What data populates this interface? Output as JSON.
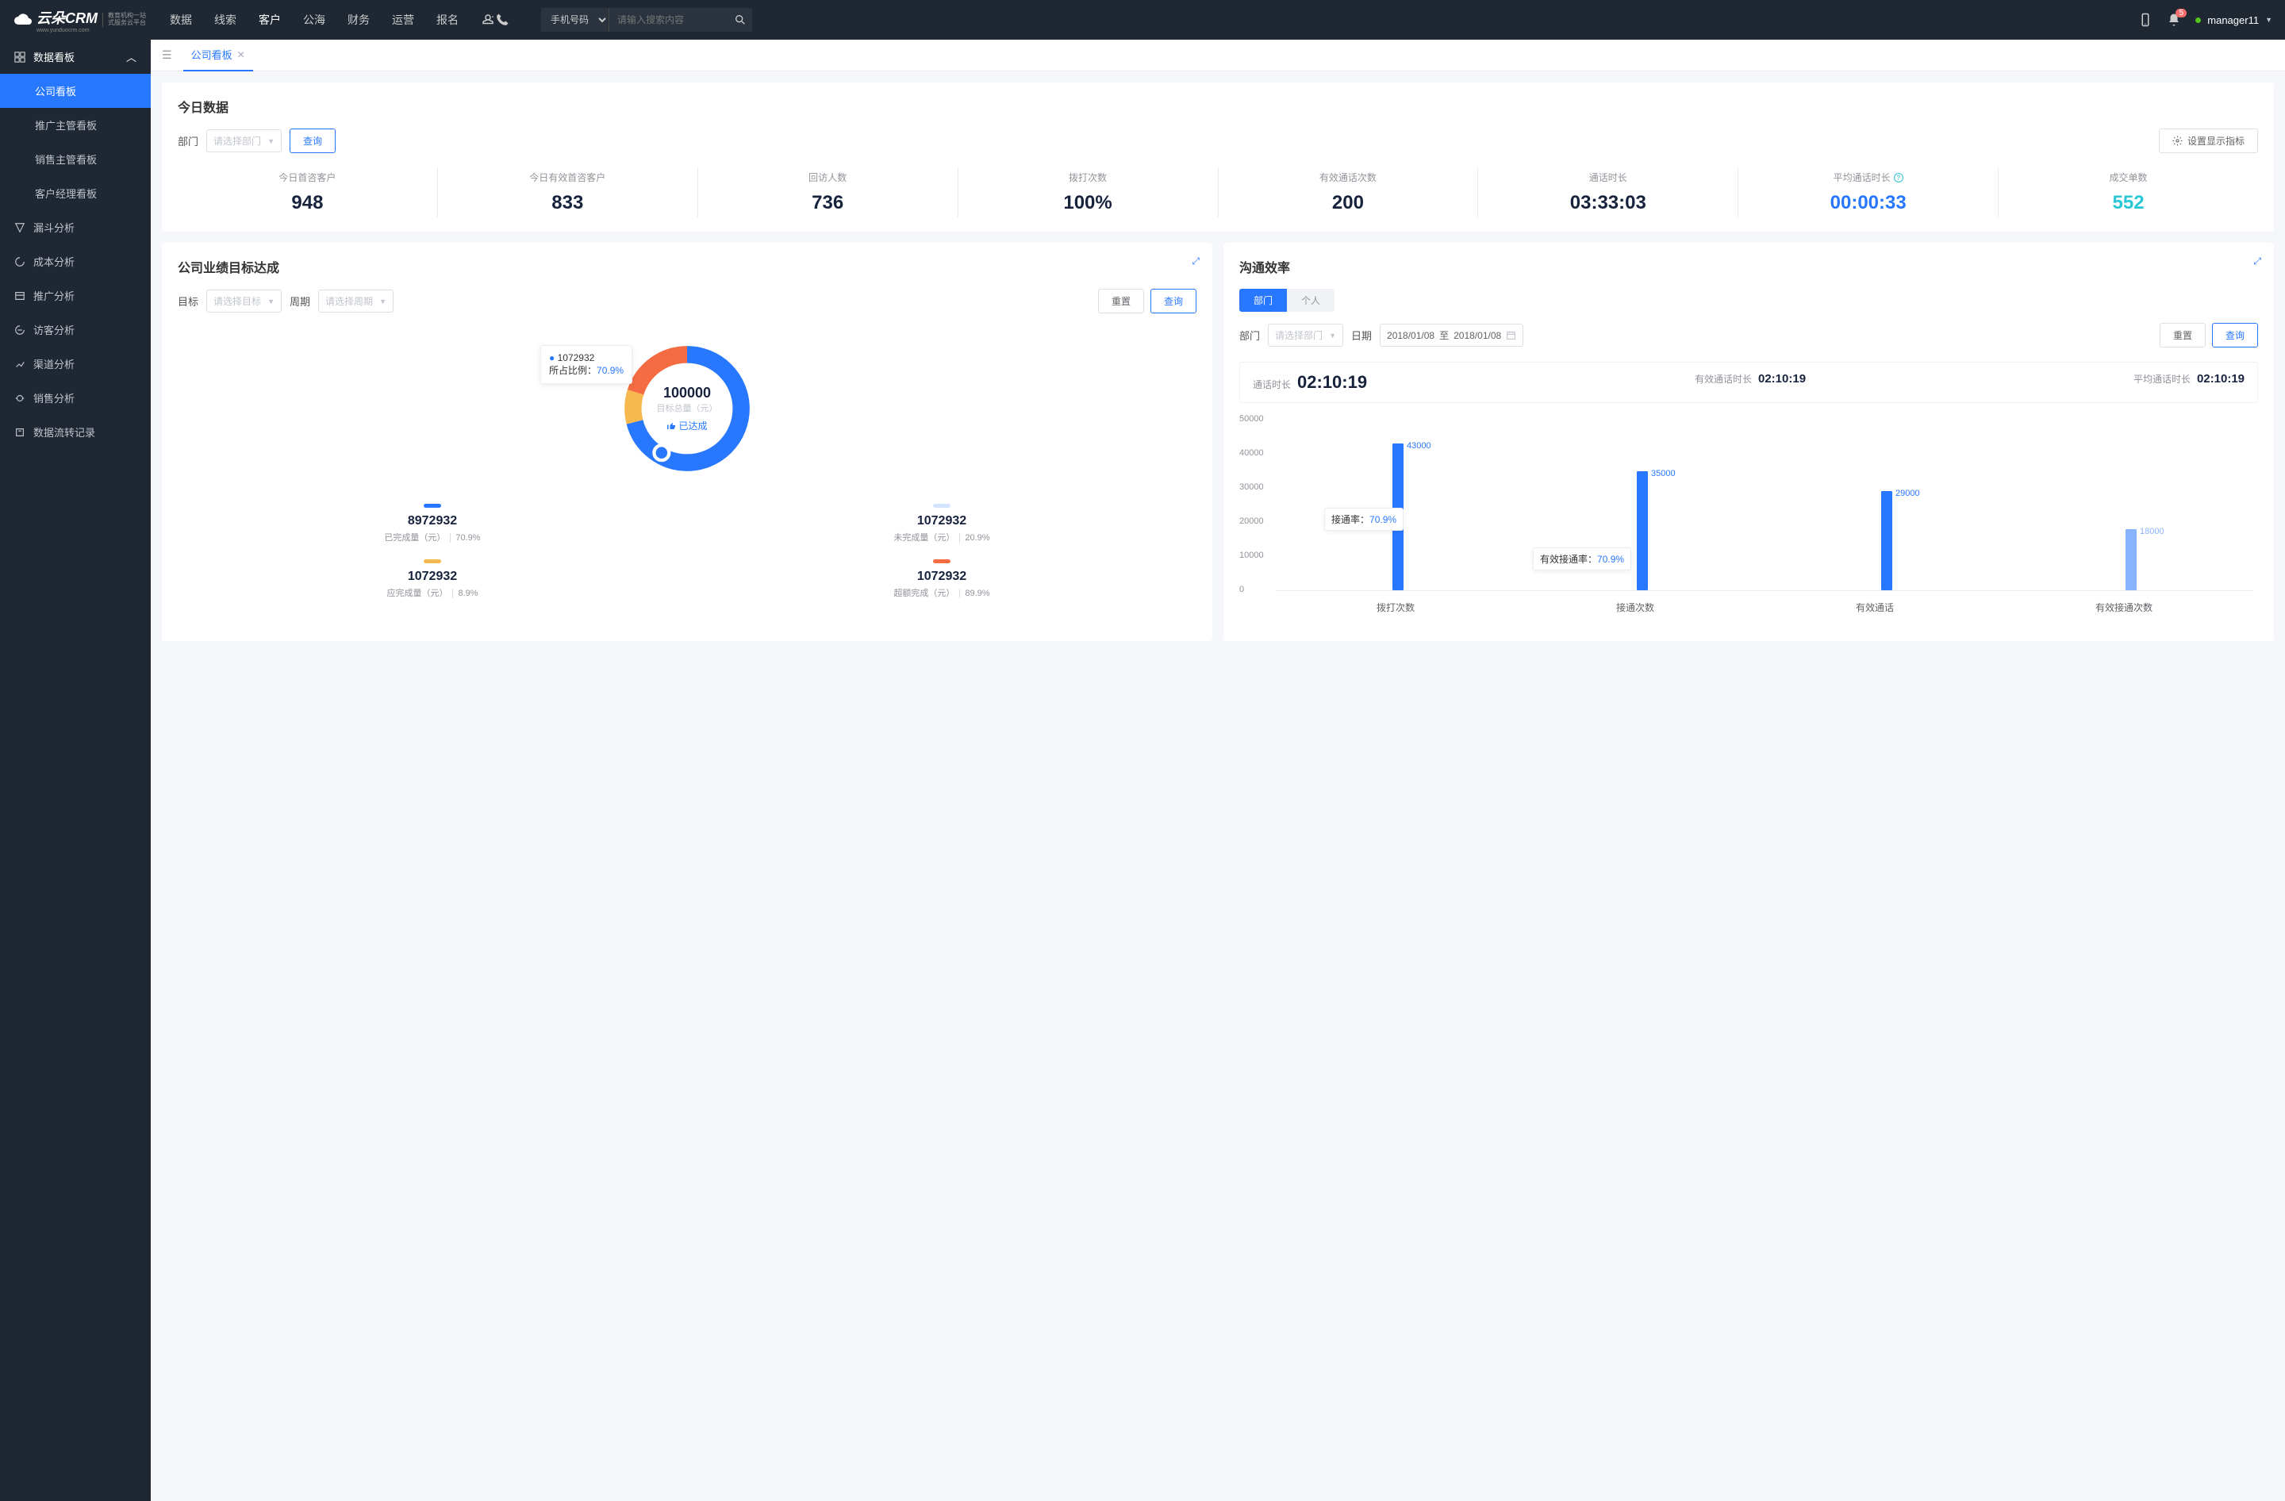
{
  "brand": {
    "name": "云朵CRM",
    "sub1": "教育机构一站",
    "sub2": "式服务云平台",
    "domain": "www.yunduocrm.com"
  },
  "nav": {
    "items": [
      "数据",
      "线索",
      "客户",
      "公海",
      "财务",
      "运营",
      "报名"
    ],
    "activeIndex": 2
  },
  "search": {
    "type": "手机号码",
    "placeholder": "请输入搜索内容"
  },
  "notif": {
    "count": "5"
  },
  "user": {
    "name": "manager11"
  },
  "sidebar": {
    "group": "数据看板",
    "subs": [
      "公司看板",
      "推广主管看板",
      "销售主管看板",
      "客户经理看板"
    ],
    "activeSub": 0,
    "items": [
      "漏斗分析",
      "成本分析",
      "推广分析",
      "访客分析",
      "渠道分析",
      "销售分析",
      "数据流转记录"
    ]
  },
  "tab": {
    "label": "公司看板"
  },
  "today": {
    "title": "今日数据",
    "deptLabel": "部门",
    "selectPlaceholder": "请选择部门",
    "queryBtn": "查询",
    "settingBtn": "设置显示指标",
    "kpis": [
      {
        "label": "今日首咨客户",
        "value": "948",
        "color": ""
      },
      {
        "label": "今日有效首咨客户",
        "value": "833",
        "color": ""
      },
      {
        "label": "回访人数",
        "value": "736",
        "color": ""
      },
      {
        "label": "拨打次数",
        "value": "100%",
        "color": ""
      },
      {
        "label": "有效通话次数",
        "value": "200",
        "color": ""
      },
      {
        "label": "通话时长",
        "value": "03:33:03",
        "color": ""
      },
      {
        "label": "平均通话时长",
        "value": "00:00:33",
        "color": "blue",
        "info": true
      },
      {
        "label": "成交单数",
        "value": "552",
        "color": "cyan"
      }
    ]
  },
  "perf": {
    "title": "公司业绩目标达成",
    "targetLabel": "目标",
    "targetPH": "请选择目标",
    "periodLabel": "周期",
    "periodPH": "请选择周期",
    "resetBtn": "重置",
    "queryBtn": "查询",
    "center": {
      "value": "100000",
      "sub": "目标总量（元）",
      "tag": "已达成"
    },
    "tooltip": {
      "value": "1072932",
      "pctLabel": "所占比例：",
      "pct": "70.9%"
    },
    "stats": [
      {
        "color": "#2878ff",
        "value": "8972932",
        "sub": "已完成量（元）",
        "pct": "70.9%"
      },
      {
        "color": "#d3e4ff",
        "value": "1072932",
        "sub": "未完成量（元）",
        "pct": "20.9%"
      },
      {
        "color": "#f7b84f",
        "value": "1072932",
        "sub": "应完成量（元）",
        "pct": "8.9%"
      },
      {
        "color": "#f56c42",
        "value": "1072932",
        "sub": "超额完成（元）",
        "pct": "89.9%"
      }
    ]
  },
  "comm": {
    "title": "沟通效率",
    "segs": [
      "部门",
      "个人"
    ],
    "segActive": 0,
    "deptLabel": "部门",
    "deptPH": "请选择部门",
    "dateLabel": "日期",
    "dateFrom": "2018/01/08",
    "dateTo": "2018/01/08",
    "dateSep": "至",
    "resetBtn": "重置",
    "queryBtn": "查询",
    "times": [
      {
        "label": "通话时长",
        "value": "02:10:19",
        "big": true
      },
      {
        "label": "有效通话时长",
        "value": "02:10:19"
      },
      {
        "label": "平均通话时长",
        "value": "02:10:19"
      }
    ],
    "float1": {
      "label": "接通率：",
      "pct": "70.9%"
    },
    "float2": {
      "label": "有效接通率：",
      "pct": "70.9%"
    }
  },
  "chart_data": {
    "type": "bar",
    "categories": [
      "拨打次数",
      "接通次数",
      "有效通话",
      "有效接通次数"
    ],
    "values": [
      43000,
      35000,
      29000,
      18000
    ],
    "ylim": [
      0,
      50000
    ],
    "yticks": [
      0,
      10000,
      20000,
      30000,
      40000,
      50000
    ]
  }
}
